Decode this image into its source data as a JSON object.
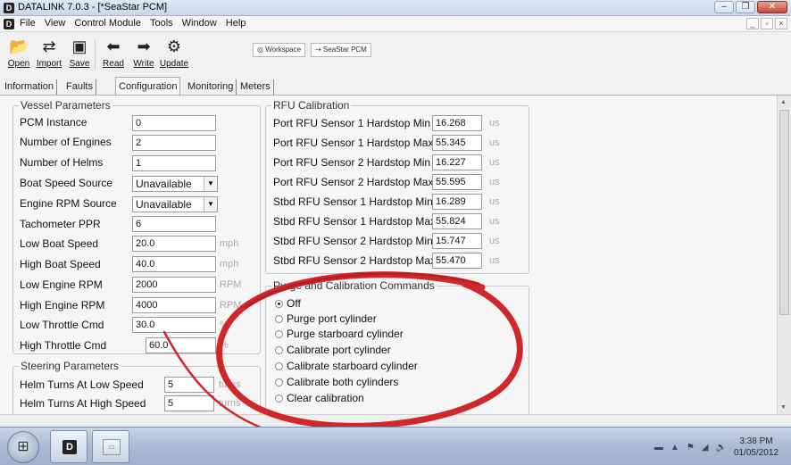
{
  "window": {
    "title": "DATALINK 7.0.3 - [*SeaStar PCM]",
    "minimize": "–",
    "maximize": "❐",
    "close": "✕"
  },
  "menu": {
    "items": [
      "File",
      "View",
      "Control Module",
      "Tools",
      "Window",
      "Help"
    ],
    "mdi_min": "_",
    "mdi_restore": "▫",
    "mdi_close": "×"
  },
  "toolbar": {
    "open": "Open",
    "import": "Import",
    "save": "Save",
    "read": "Read",
    "write": "Write",
    "update": "Update",
    "workspace": "Workspace",
    "seastar": "SeaStar PCM"
  },
  "tabs": [
    "Information",
    "Faults",
    "Configuration",
    "Monitoring",
    "Meters"
  ],
  "active_tab": "Configuration",
  "vessel": {
    "legend": "Vessel Parameters",
    "rows": [
      {
        "label": "PCM Instance",
        "value": "0",
        "unit": ""
      },
      {
        "label": "Number of Engines",
        "value": "2",
        "unit": ""
      },
      {
        "label": "Number of Helms",
        "value": "1",
        "unit": ""
      },
      {
        "label": "Boat Speed Source",
        "value": "Unavailable",
        "unit": ""
      },
      {
        "label": "Engine RPM Source",
        "value": "Unavailable",
        "unit": ""
      },
      {
        "label": "Tachometer PPR",
        "value": "6",
        "unit": ""
      },
      {
        "label": "Low Boat Speed",
        "value": "20.0",
        "unit": "mph"
      },
      {
        "label": "High Boat Speed",
        "value": "40.0",
        "unit": "mph"
      },
      {
        "label": "Low Engine RPM",
        "value": "2000",
        "unit": "RPM"
      },
      {
        "label": "High Engine RPM",
        "value": "4000",
        "unit": "RPM"
      },
      {
        "label": "Low Throttle Cmd",
        "value": "30.0",
        "unit": "%"
      },
      {
        "label": "High Throttle Cmd",
        "value": "60.0",
        "unit": "%"
      }
    ]
  },
  "steering": {
    "legend": "Steering Parameters",
    "rows": [
      {
        "label": "Helm Turns At Low Speed",
        "value": "5",
        "unit": "turns"
      },
      {
        "label": "Helm Turns At High Speed",
        "value": "5",
        "unit": "turns"
      }
    ]
  },
  "rfu": {
    "legend": "RFU Calibration",
    "rows": [
      {
        "label": "Port RFU Sensor 1 Hardstop Min",
        "value": "16.268",
        "unit": "us"
      },
      {
        "label": "Port RFU Sensor 1 Hardstop Max",
        "value": "55.345",
        "unit": "us"
      },
      {
        "label": "Port RFU Sensor 2 Hardstop Min",
        "value": "16.227",
        "unit": "us"
      },
      {
        "label": "Port RFU Sensor 2 Hardstop Max",
        "value": "55.595",
        "unit": "us"
      },
      {
        "label": "Stbd RFU Sensor 1 Hardstop Min",
        "value": "16.289",
        "unit": "us"
      },
      {
        "label": "Stbd RFU Sensor 1 Hardstop Max",
        "value": "55.824",
        "unit": "us"
      },
      {
        "label": "Stbd RFU Sensor 2 Hardstop Min",
        "value": "15.747",
        "unit": "us"
      },
      {
        "label": "Stbd RFU Sensor 2 Hardstop Max",
        "value": "55.470",
        "unit": "us"
      }
    ]
  },
  "purge": {
    "legend": "Purge and Calibration Commands",
    "options": [
      "Off",
      "Purge port cylinder",
      "Purge starboard cylinder",
      "Calibrate port cylinder",
      "Calibrate starboard cylinder",
      "Calibrate both cylinders",
      "Clear calibration"
    ],
    "selected": "Off"
  },
  "taskbar": {
    "time": "3:38 PM",
    "date": "01/05/2012"
  },
  "colors": {
    "annotation": "#d0272b",
    "unit_text": "#aaaaaa"
  }
}
